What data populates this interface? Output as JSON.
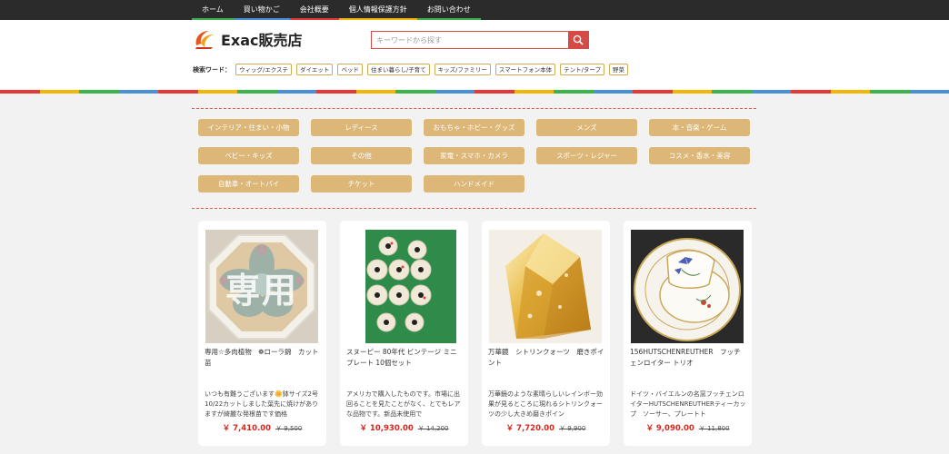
{
  "nav": {
    "items": [
      {
        "label": "ホーム",
        "color": "#3cb44b"
      },
      {
        "label": "買い物かご",
        "color": "#4a90d9"
      },
      {
        "label": "会社概要",
        "color": "#e53935"
      },
      {
        "label": "個人情報保護方針",
        "color": "#f2b705"
      },
      {
        "label": "お問い合わせ",
        "color": "#3cb44b"
      }
    ]
  },
  "header": {
    "logo_text": "Exac販売店",
    "search_placeholder": "キーワードから探す",
    "keywords_label": "検索ワード：",
    "keywords": [
      "ウィッグ/エクステ",
      "ダイエット",
      "ベッド",
      "住まい暮らし/子育て",
      "キッズ/ファミリー",
      "スマートフォン本体",
      "テント/タープ",
      "野菜"
    ]
  },
  "categories": [
    "インテリア・住まい・小物",
    "レディース",
    "おもちゃ・ホビー・グッズ",
    "メンズ",
    "本・音楽・ゲーム",
    "ベビー・キッズ",
    "その他",
    "家電・スマホ・カメラ",
    "スポーツ・レジャー",
    "コスメ・香水・美容",
    "自動車・オートバイ",
    "チケット",
    "ハンドメイド"
  ],
  "products": [
    {
      "title": "専用☆多肉植物　❁ローラ錦　カット苗",
      "description": "いつも有難うございます🌼鉢サイズ2号10/22カットしました葉先に焼けがありますが綺麗な発根苗です価格",
      "price": "￥ 7,410.00",
      "old_price": "￥ 9,500",
      "overlay_text": "専用"
    },
    {
      "title": "スヌーピー 80年代 ビンテージ ミニプレート 10個セット",
      "description": "アメリカで購入したものです。市場に出回ることを見たことがなく、とてもレアな品物です。新品未使用で",
      "price": "￥ 10,930.00",
      "old_price": "￥ 14,200"
    },
    {
      "title": "万華鏡　シトリンクォーツ　磨きポイント",
      "description": "万華鏡のような素晴らしいレインボー効果が見るところに現れるシトリンクォーツの少し大きめ磨きポイン",
      "price": "￥ 7,720.00",
      "old_price": "￥ 9,900"
    },
    {
      "title": "156HUTSCHENREUTHER　フッチェンロイター トリオ",
      "description": "ドイツ・バイエルンの名窯フッチェンロイターHUTSCHENREUTHERティーカップ　ソーサー、プレートト",
      "price": "￥ 9,090.00",
      "old_price": "￥ 11,800"
    }
  ],
  "colors": {
    "accent": "#d64a45",
    "category_bg": "#dcb778",
    "price": "#d9271c"
  }
}
